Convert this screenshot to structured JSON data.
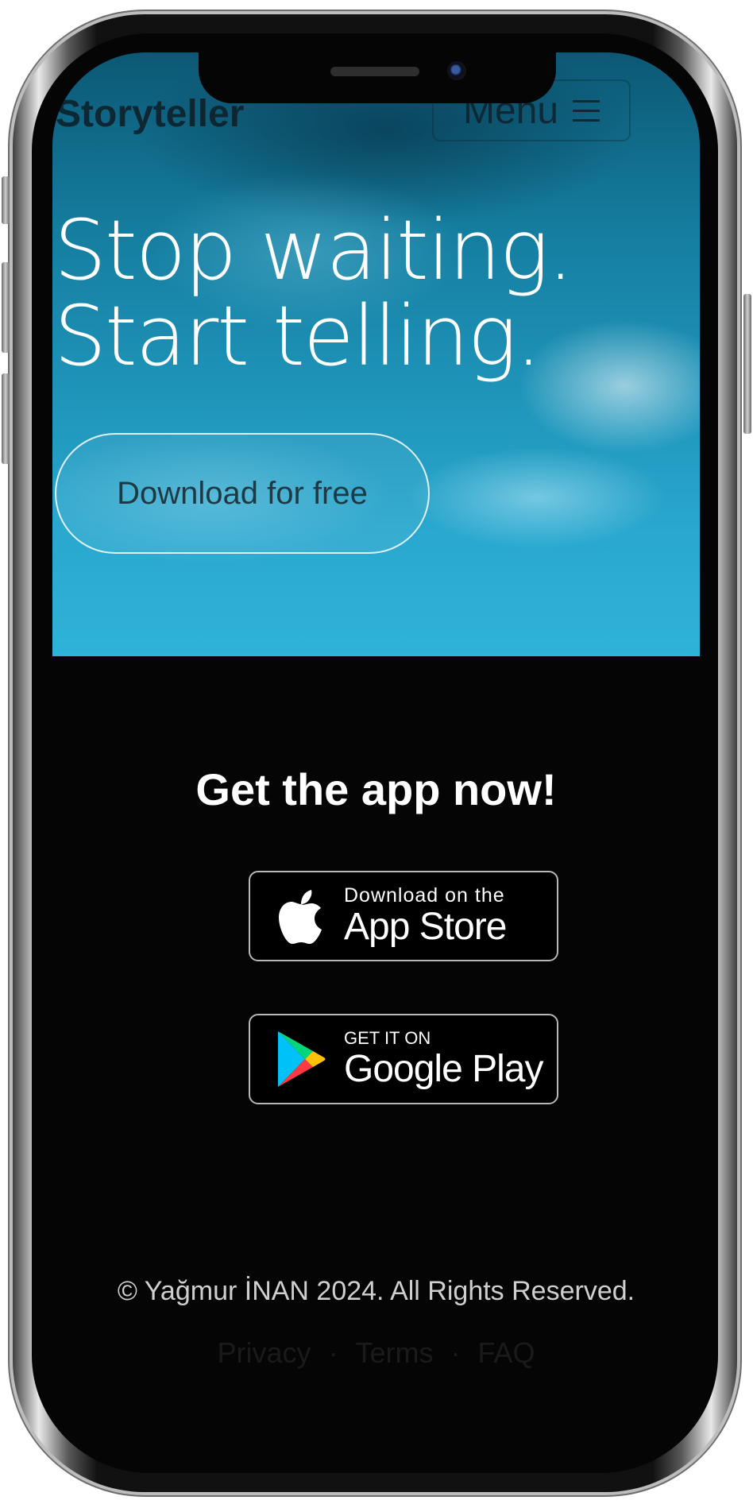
{
  "nav": {
    "brand": "Storyteller",
    "menu_label": "Menu"
  },
  "hero": {
    "headline_line1": "Stop waiting.",
    "headline_line2": "Start telling.",
    "cta_label": "Download for free"
  },
  "app_section": {
    "heading": "Get the app now!",
    "app_store": {
      "small": "Download on the",
      "big": "App Store",
      "icon": "apple-icon"
    },
    "google_play": {
      "small": "GET IT ON",
      "big": "Google Play",
      "icon": "google-play-icon"
    }
  },
  "footer": {
    "copyright": "© Yağmur İNAN 2024. All Rights Reserved.",
    "links": [
      "Privacy",
      "Terms",
      "FAQ"
    ],
    "separator": "·"
  },
  "colors": {
    "sky_top": "#0c5874",
    "sky_bottom": "#2fb3d8",
    "page_bg": "#050505",
    "text_white": "#ffffff"
  }
}
